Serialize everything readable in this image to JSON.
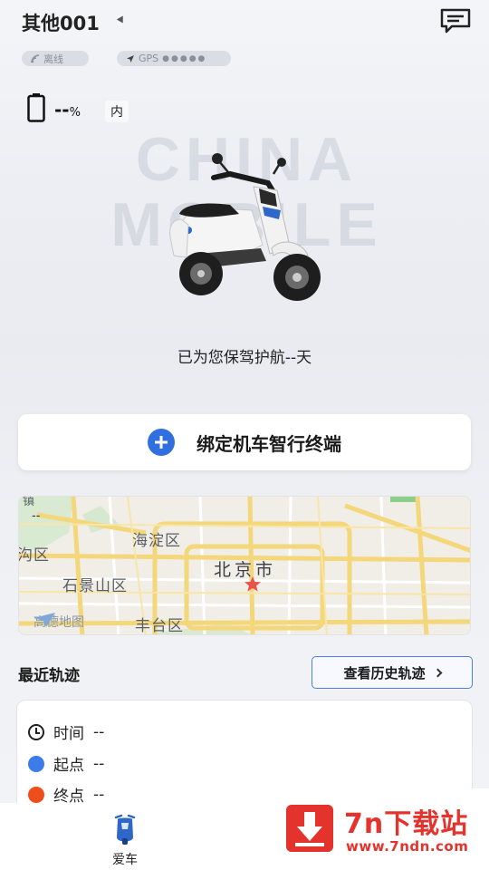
{
  "header": {
    "device_name": "其他001",
    "offline_label": "离线",
    "gps_label": "GPS",
    "gps_dots": "●●●●●"
  },
  "battery": {
    "value": "--",
    "unit": "%",
    "location": "内"
  },
  "hero": {
    "watermark_line1": "CHINA",
    "watermark_line2": "MOBILE",
    "protect_text": "已为您保驾护航--天"
  },
  "bind": {
    "label": "绑定机车智行终端"
  },
  "map": {
    "value": "--",
    "labels": {
      "haidian": "海淀区",
      "beijing": "北京市",
      "shijingshan": "石景山区",
      "fengtai": "丰台区",
      "gou": "沟区",
      "zhen": "镇"
    },
    "provider": "高德地图"
  },
  "recent": {
    "title": "最近轨迹",
    "history_button": "查看历史轨迹",
    "time_label": "时间",
    "time_value": "--",
    "start_label": "起点",
    "start_value": "--",
    "end_label": "终点",
    "end_value": "--",
    "start_color": "#3b7ce8",
    "end_color": "#ee4d1c"
  },
  "tabbar": {
    "car_label": "爱车"
  },
  "ad": {
    "title": "7n下载站",
    "url": "www.7ndn.com"
  }
}
